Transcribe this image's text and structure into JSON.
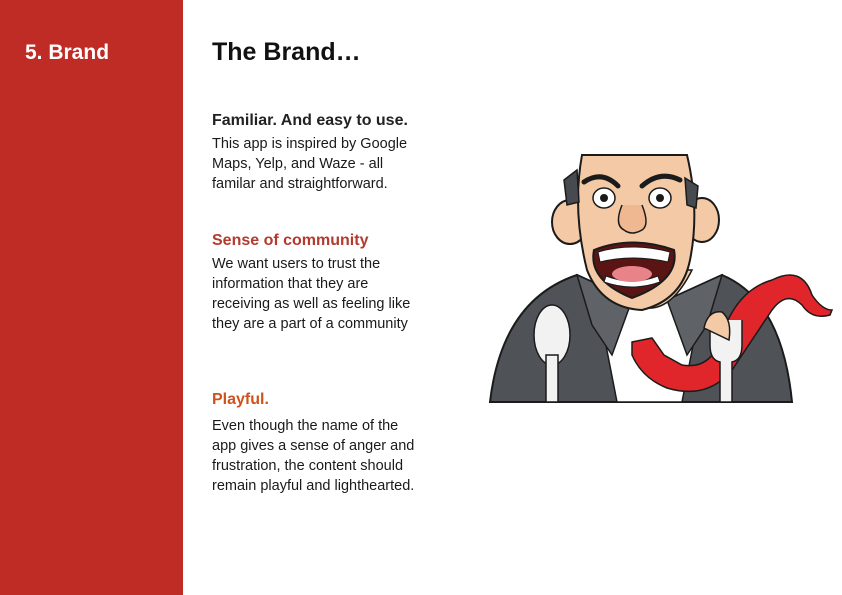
{
  "sidebar": {
    "section_label": "5. Brand",
    "color": "#bf2c26"
  },
  "main": {
    "title": "The Brand…",
    "sections": [
      {
        "heading": "Familiar. And easy to use.",
        "heading_color": "#222222",
        "body": "This app is inspired by Google Maps, Yelp, and Waze - all familar and straightforward."
      },
      {
        "heading": "Sense of community",
        "heading_color": "#b33a2e",
        "body": "We want users to trust the information that they are receiving as well as feeling like they are a part of a community"
      },
      {
        "heading": "Playful.",
        "heading_color": "#d0521b",
        "body": "Even though the name of the app gives a sense of anger and frustration, the content should remain playful and lighthearted."
      }
    ]
  },
  "illustration": {
    "icon": "angry-businessman-illustration"
  }
}
